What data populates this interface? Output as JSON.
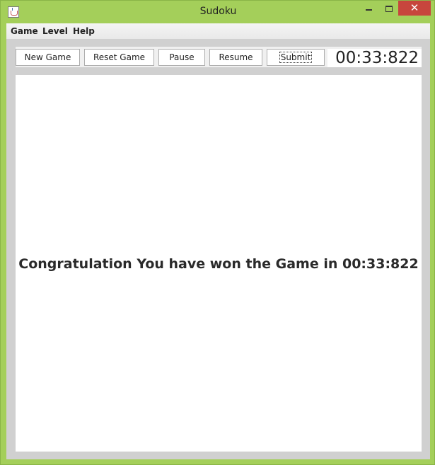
{
  "window": {
    "title": "Sudoku",
    "close_symbol": "✕",
    "controls": [
      "minimize-icon",
      "maximize-icon",
      "close-icon"
    ]
  },
  "menu": {
    "items": [
      "Game",
      "Level",
      "Help"
    ]
  },
  "toolbar": {
    "new_game": "New Game",
    "reset_game": "Reset Game",
    "pause": "Pause",
    "resume": "Resume",
    "submit": "Submit"
  },
  "timer": {
    "value": "00:33:822"
  },
  "board": {
    "message": "Congratulation You have won the Game in 00:33:822"
  },
  "colors": {
    "window_frame": "#a4cf5a",
    "close_button": "#c7463d",
    "panel_background": "#d0d0d0"
  }
}
